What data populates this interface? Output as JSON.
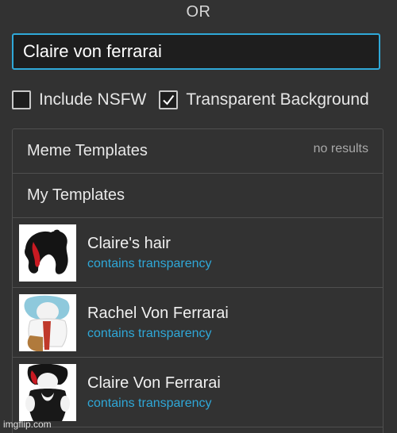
{
  "header": {
    "or_label": "OR"
  },
  "search": {
    "value": "Claire von ferrarai"
  },
  "options": {
    "nsfw": {
      "label": "Include NSFW",
      "checked": false
    },
    "transparent": {
      "label": "Transparent Background",
      "checked": true
    }
  },
  "sections": {
    "meme_templates": {
      "title": "Meme Templates",
      "status": "no results"
    },
    "my_templates": {
      "title": "My Templates"
    }
  },
  "results": [
    {
      "title": "Claire's hair",
      "subtitle": "contains transparency"
    },
    {
      "title": "Rachel Von Ferrarai",
      "subtitle": "contains transparency"
    },
    {
      "title": "Claire Von Ferrarai",
      "subtitle": "contains transparency"
    }
  ],
  "watermark": "imgflip.com"
}
